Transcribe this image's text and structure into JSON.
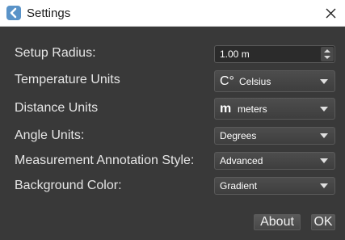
{
  "window": {
    "title": "Settings",
    "app_icon": "back-arrow-icon",
    "close_icon": "close-icon"
  },
  "settings": {
    "setup_radius": {
      "label": "Setup Radius:",
      "value": "1.00 m"
    },
    "temperature_units": {
      "label": "Temperature Units",
      "glyph": "C°",
      "value": "Celsius"
    },
    "distance_units": {
      "label": "Distance Units",
      "glyph": "m",
      "value": "meters"
    },
    "angle_units": {
      "label": "Angle Units:",
      "value": "Degrees"
    },
    "annotation_style": {
      "label": "Measurement Annotation Style:",
      "value": "Advanced"
    },
    "background_color": {
      "label": "Background Color:",
      "value": "Gradient"
    }
  },
  "buttons": {
    "about": "About",
    "ok": "OK"
  },
  "colors": {
    "background": "#393939",
    "titlebar": "#ffffff",
    "text": "#e6e6e6",
    "icon": "#5a93c8"
  }
}
